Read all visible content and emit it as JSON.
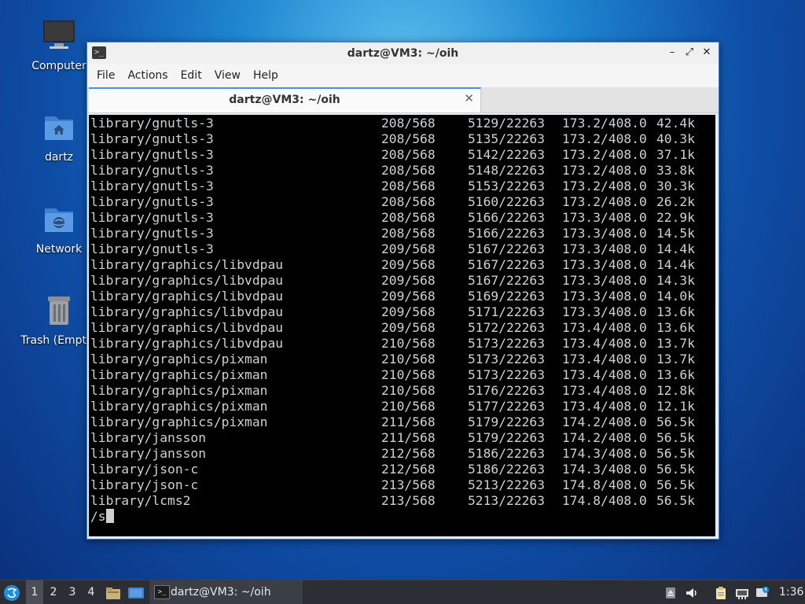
{
  "desktop": {
    "icons": [
      {
        "label": "Computer"
      },
      {
        "label": "dartz"
      },
      {
        "label": "Network"
      },
      {
        "label": "Trash (Empty)"
      }
    ]
  },
  "window": {
    "title": "dartz@VM3: ~/oih",
    "menu": [
      "File",
      "Actions",
      "Edit",
      "View",
      "Help"
    ],
    "tab_title": "dartz@VM3: ~/oih"
  },
  "terminal": {
    "rows": [
      {
        "name": "library/gnutls-3",
        "a": "208/568",
        "b": "5129/22263",
        "c": "173.2/408.0",
        "d": "42.4k"
      },
      {
        "name": "library/gnutls-3",
        "a": "208/568",
        "b": "5135/22263",
        "c": "173.2/408.0",
        "d": "40.3k"
      },
      {
        "name": "library/gnutls-3",
        "a": "208/568",
        "b": "5142/22263",
        "c": "173.2/408.0",
        "d": "37.1k"
      },
      {
        "name": "library/gnutls-3",
        "a": "208/568",
        "b": "5148/22263",
        "c": "173.2/408.0",
        "d": "33.8k"
      },
      {
        "name": "library/gnutls-3",
        "a": "208/568",
        "b": "5153/22263",
        "c": "173.2/408.0",
        "d": "30.3k"
      },
      {
        "name": "library/gnutls-3",
        "a": "208/568",
        "b": "5160/22263",
        "c": "173.2/408.0",
        "d": "26.2k"
      },
      {
        "name": "library/gnutls-3",
        "a": "208/568",
        "b": "5166/22263",
        "c": "173.3/408.0",
        "d": "22.9k"
      },
      {
        "name": "library/gnutls-3",
        "a": "208/568",
        "b": "5166/22263",
        "c": "173.3/408.0",
        "d": "14.5k"
      },
      {
        "name": "library/gnutls-3",
        "a": "209/568",
        "b": "5167/22263",
        "c": "173.3/408.0",
        "d": "14.4k"
      },
      {
        "name": "library/graphics/libvdpau",
        "a": "209/568",
        "b": "5167/22263",
        "c": "173.3/408.0",
        "d": "14.4k"
      },
      {
        "name": "library/graphics/libvdpau",
        "a": "209/568",
        "b": "5167/22263",
        "c": "173.3/408.0",
        "d": "14.3k"
      },
      {
        "name": "library/graphics/libvdpau",
        "a": "209/568",
        "b": "5169/22263",
        "c": "173.3/408.0",
        "d": "14.0k"
      },
      {
        "name": "library/graphics/libvdpau",
        "a": "209/568",
        "b": "5171/22263",
        "c": "173.3/408.0",
        "d": "13.6k"
      },
      {
        "name": "library/graphics/libvdpau",
        "a": "209/568",
        "b": "5172/22263",
        "c": "173.4/408.0",
        "d": "13.6k"
      },
      {
        "name": "library/graphics/libvdpau",
        "a": "210/568",
        "b": "5173/22263",
        "c": "173.4/408.0",
        "d": "13.7k"
      },
      {
        "name": "library/graphics/pixman",
        "a": "210/568",
        "b": "5173/22263",
        "c": "173.4/408.0",
        "d": "13.7k"
      },
      {
        "name": "library/graphics/pixman",
        "a": "210/568",
        "b": "5173/22263",
        "c": "173.4/408.0",
        "d": "13.6k"
      },
      {
        "name": "library/graphics/pixman",
        "a": "210/568",
        "b": "5176/22263",
        "c": "173.4/408.0",
        "d": "12.8k"
      },
      {
        "name": "library/graphics/pixman",
        "a": "210/568",
        "b": "5177/22263",
        "c": "173.4/408.0",
        "d": "12.1k"
      },
      {
        "name": "library/graphics/pixman",
        "a": "211/568",
        "b": "5179/22263",
        "c": "174.2/408.0",
        "d": "56.5k"
      },
      {
        "name": "library/jansson",
        "a": "211/568",
        "b": "5179/22263",
        "c": "174.2/408.0",
        "d": "56.5k"
      },
      {
        "name": "library/jansson",
        "a": "212/568",
        "b": "5186/22263",
        "c": "174.3/408.0",
        "d": "56.5k"
      },
      {
        "name": "library/json-c",
        "a": "212/568",
        "b": "5186/22263",
        "c": "174.3/408.0",
        "d": "56.5k"
      },
      {
        "name": "library/json-c",
        "a": "213/568",
        "b": "5213/22263",
        "c": "174.8/408.0",
        "d": "56.5k"
      },
      {
        "name": "library/lcms2",
        "a": "213/568",
        "b": "5213/22263",
        "c": "174.8/408.0",
        "d": "56.5k"
      }
    ],
    "prompt": "/s"
  },
  "taskbar": {
    "workspaces": [
      "1",
      "2",
      "3",
      "4"
    ],
    "active_workspace": "1",
    "task_label": "dartz@VM3: ~/oih",
    "clock": "1:36"
  }
}
